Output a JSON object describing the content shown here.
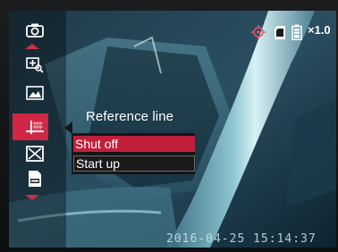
{
  "colors": {
    "accent": "#d02746",
    "menu_bg": "#161616",
    "text": "#ffffff"
  },
  "sidebar": {
    "items": [
      {
        "icon": "zoom-in-icon"
      },
      {
        "icon": "gallery-icon"
      },
      {
        "icon": "reference-line-icon",
        "selected": true
      },
      {
        "icon": "close-box-icon"
      },
      {
        "icon": "file-icon"
      }
    ]
  },
  "toolbar": {
    "icon": "camera-icon"
  },
  "menu": {
    "title": "Reference line",
    "options": [
      {
        "label": "Shut off",
        "selected": true
      },
      {
        "label": "Start up",
        "selected": false
      }
    ]
  },
  "status": {
    "icons": [
      "target-icon",
      "sd-card-icon",
      "battery-icon"
    ],
    "zoom": "×1.0"
  },
  "timestamp": "2016-04-25 15:14:37"
}
